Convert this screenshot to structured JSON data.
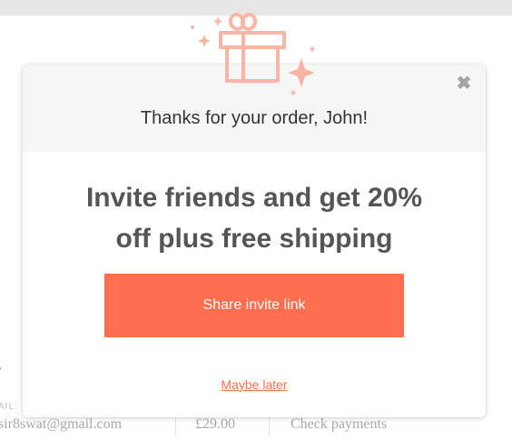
{
  "modal": {
    "header_text": "Thanks for your order, John!",
    "close_glyph": "✖",
    "headline_line1": "Invite friends and get 20%",
    "headline_line2": "off plus free shipping",
    "share_label": "Share invite link",
    "maybe_later_label": "Maybe later",
    "icon": "gift-icon"
  },
  "background": {
    "email_label": "AIL:",
    "email": "sir8swat@gmail.com",
    "price": "£29.00",
    "action": "Check payments"
  },
  "colors": {
    "accent": "#ff6e4f",
    "gift_icon": "#f9b5a5",
    "header_bg": "#f6f6f6",
    "headline_text": "#555555"
  }
}
